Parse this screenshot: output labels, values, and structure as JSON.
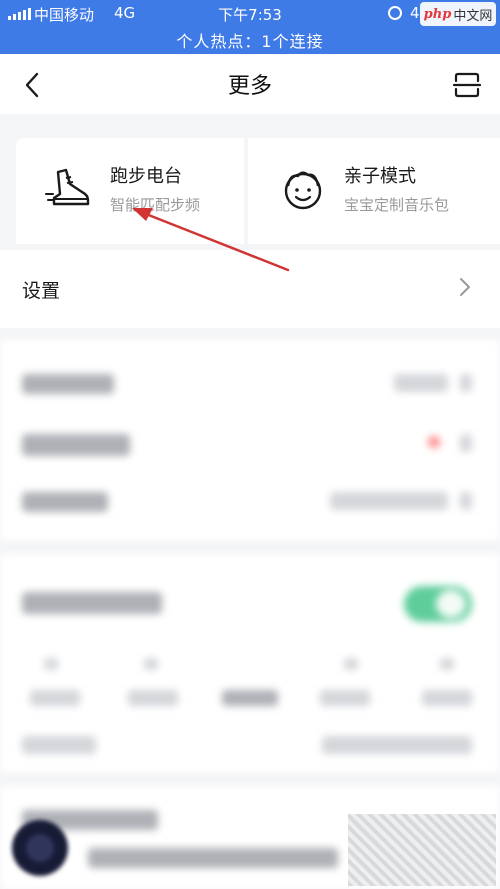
{
  "status_bar": {
    "carrier": "中国移动",
    "network": "4G",
    "time": "下午7:53",
    "battery_text": "4",
    "hotspot": "个人热点：1个连接"
  },
  "watermark": {
    "brand": "php",
    "suffix": "中文网"
  },
  "nav": {
    "title": "更多",
    "back_icon": "chevron-left-icon",
    "scan_icon": "scan-icon"
  },
  "features": [
    {
      "title": "跑步电台",
      "subtitle": "智能匹配步频",
      "icon": "running-shoe-icon"
    },
    {
      "title": "亲子模式",
      "subtitle": "宝宝定制音乐包",
      "icon": "baby-face-icon"
    }
  ],
  "settings": {
    "label": "设置",
    "icon": "chevron-right-icon"
  },
  "colors": {
    "status_bar": "#3f7be6",
    "annotation_arrow": "#d23434",
    "toggle_on": "#5ecd9a"
  }
}
